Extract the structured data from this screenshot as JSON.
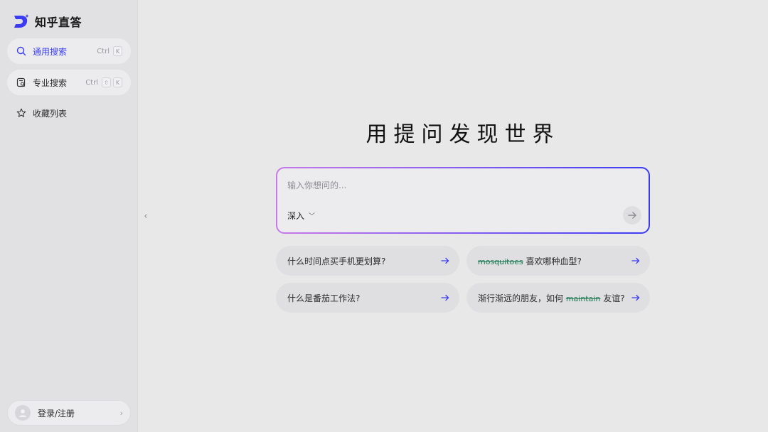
{
  "brand": {
    "name": "知乎直答",
    "accent": "#3b3cf2"
  },
  "sidebar": {
    "items": [
      {
        "label": "通用搜索",
        "icon": "search-icon",
        "shortcut": [
          "Ctrl",
          "K"
        ]
      },
      {
        "label": "专业搜索",
        "icon": "document-search-icon",
        "shortcut": [
          "Ctrl",
          "⇧",
          "K"
        ]
      },
      {
        "label": "收藏列表",
        "icon": "star-icon"
      }
    ],
    "login_label": "登录/注册"
  },
  "main": {
    "title": "用提问发现世界",
    "search": {
      "placeholder": "输入你想问的...",
      "mode": "深入"
    },
    "suggestions": [
      {
        "prefix": "",
        "highlight": "",
        "suffix": "什么时间点买手机更划算?"
      },
      {
        "prefix": "",
        "highlight": "mosquitoes",
        "suffix": " 喜欢哪种血型?"
      },
      {
        "prefix": "",
        "highlight": "",
        "suffix": "什么是番茄工作法?"
      },
      {
        "prefix": "渐行渐远的朋友，如何 ",
        "highlight": "maintain",
        "suffix": " 友谊?"
      }
    ]
  }
}
